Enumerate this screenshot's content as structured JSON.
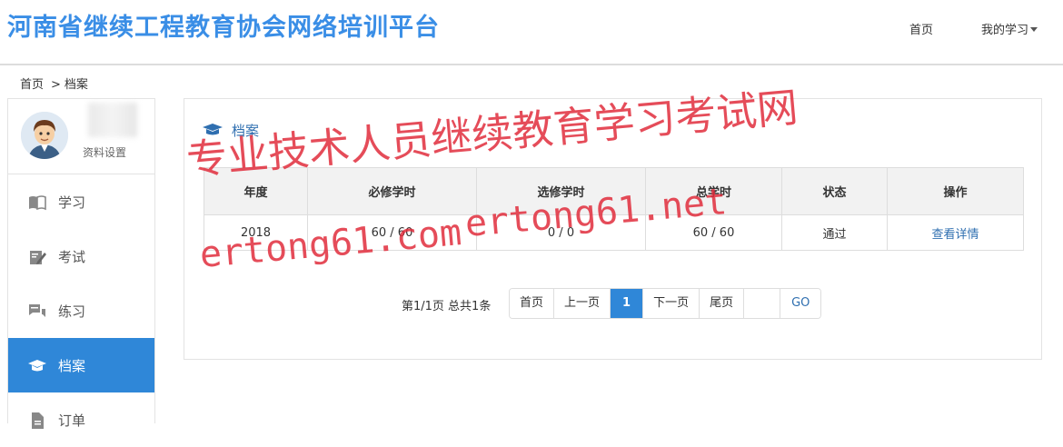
{
  "header": {
    "site_title": "河南省继续工程教育协会网络培训平台",
    "nav_home": "首页",
    "nav_my_study": "我的学习"
  },
  "breadcrumb": {
    "home": "首页",
    "separator": ">",
    "current": "档案"
  },
  "sidebar": {
    "profile_settings": "资料设置",
    "items": [
      {
        "label": "学习",
        "icon": "book-icon",
        "active": false
      },
      {
        "label": "考试",
        "icon": "edit-icon",
        "active": false
      },
      {
        "label": "练习",
        "icon": "chat-icon",
        "active": false
      },
      {
        "label": "档案",
        "icon": "graduation-cap-icon",
        "active": true
      },
      {
        "label": "订单",
        "icon": "file-icon",
        "active": false
      }
    ]
  },
  "panel": {
    "title": "档案",
    "table": {
      "headers": [
        "年度",
        "必修学时",
        "选修学时",
        "总学时",
        "状态",
        "操作"
      ],
      "rows": [
        {
          "year": "2018",
          "required": "60 / 60",
          "elective": "0 / 0",
          "total": "60 / 60",
          "status": "通过",
          "action": "查看详情"
        }
      ]
    },
    "pager": {
      "info": "第1/1页 总共1条",
      "first": "首页",
      "prev": "上一页",
      "current": "1",
      "next": "下一页",
      "last": "尾页",
      "go": "GO"
    }
  },
  "watermark": {
    "text_cn": "专业技术人员继续教育学习考试网",
    "url_1": "ertong61.com",
    "url_2": "ertong61.net"
  },
  "colors": {
    "accent": "#2f87d8",
    "title_blue": "#3a8ee6",
    "link": "#2f6fb0",
    "watermark": "#e12d3c"
  }
}
